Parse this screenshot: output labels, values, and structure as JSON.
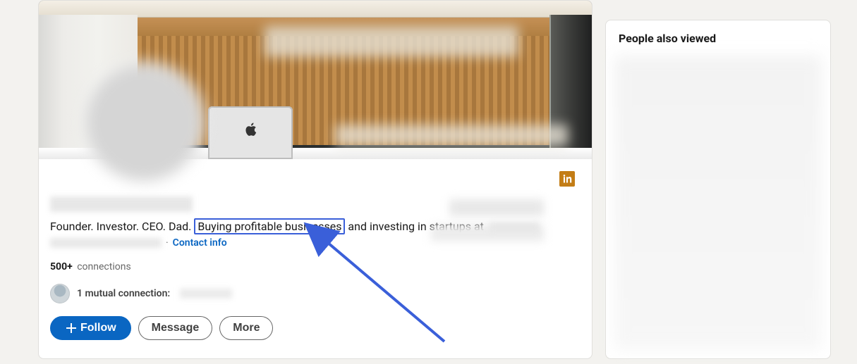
{
  "profile": {
    "headline_part1": "Founder. Investor. CEO. Dad.",
    "headline_highlight": "Buying profitable businesses",
    "headline_part2": "and investing in startups at",
    "contact_info_label": "Contact info",
    "contact_separator": "·",
    "connections_count": "500+",
    "connections_label": "connections",
    "mutual_label": "1 mutual connection:"
  },
  "actions": {
    "follow": "Follow",
    "message": "Message",
    "more": "More"
  },
  "sidebar": {
    "title": "People also viewed"
  },
  "colors": {
    "primary": "#0a66c2",
    "annotation": "#3a5fd9"
  }
}
